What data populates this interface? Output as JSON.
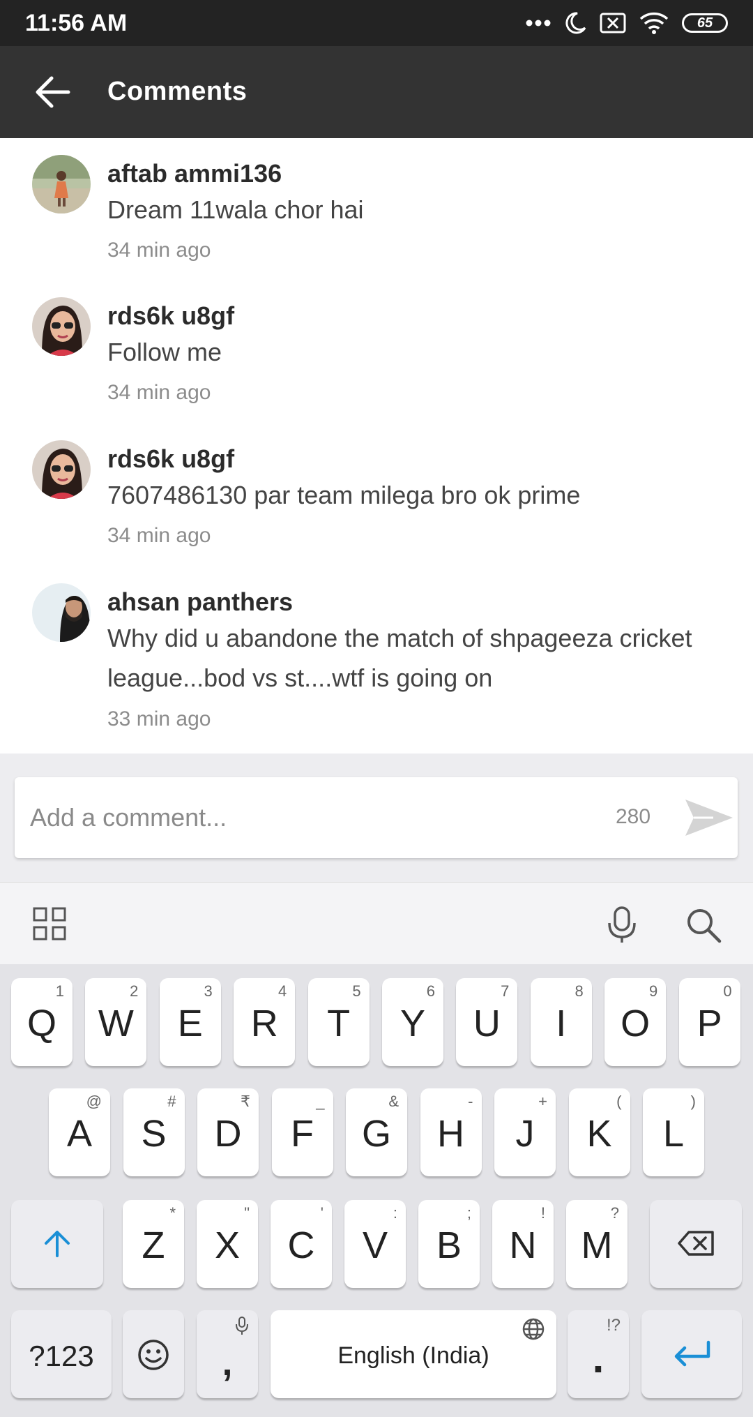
{
  "status_bar": {
    "time": "11:56 AM",
    "battery": "65",
    "icons": [
      "more-dots-icon",
      "moon-icon",
      "data-off-icon",
      "wifi-icon",
      "battery-icon"
    ]
  },
  "app_bar": {
    "title": "Comments",
    "back_icon": "back-arrow-icon"
  },
  "comments": [
    {
      "author": "aftab ammi136",
      "text": "Dream 11wala chor hai",
      "time": "34 min ago"
    },
    {
      "author": "rds6k u8gf",
      "text": "Follow me",
      "time": "34 min ago"
    },
    {
      "author": "rds6k u8gf",
      "text": "7607486130 par team milega bro ok prime",
      "time": "34 min ago"
    },
    {
      "author": "ahsan panthers",
      "text": "Why did u abandone the match of shpageeza cricket league...bod vs st....wtf is going on",
      "time": "33 min ago"
    }
  ],
  "comment_input": {
    "placeholder": "Add a comment...",
    "value": "",
    "char_count": "280"
  },
  "keyboard": {
    "toolbar": [
      "grid-icon",
      "microphone-icon",
      "search-icon"
    ],
    "row1": [
      {
        "key": "Q",
        "sub": "1"
      },
      {
        "key": "W",
        "sub": "2"
      },
      {
        "key": "E",
        "sub": "3"
      },
      {
        "key": "R",
        "sub": "4"
      },
      {
        "key": "T",
        "sub": "5"
      },
      {
        "key": "Y",
        "sub": "6"
      },
      {
        "key": "U",
        "sub": "7"
      },
      {
        "key": "I",
        "sub": "8"
      },
      {
        "key": "O",
        "sub": "9"
      },
      {
        "key": "P",
        "sub": "0"
      }
    ],
    "row2": [
      {
        "key": "A",
        "sub": "@"
      },
      {
        "key": "S",
        "sub": "#"
      },
      {
        "key": "D",
        "sub": "₹"
      },
      {
        "key": "F",
        "sub": "_"
      },
      {
        "key": "G",
        "sub": "&"
      },
      {
        "key": "H",
        "sub": "-"
      },
      {
        "key": "J",
        "sub": "+"
      },
      {
        "key": "K",
        "sub": "("
      },
      {
        "key": "L",
        "sub": ")"
      }
    ],
    "row3": [
      {
        "key": "Z",
        "sub": "*"
      },
      {
        "key": "X",
        "sub": "\""
      },
      {
        "key": "C",
        "sub": "'"
      },
      {
        "key": "V",
        "sub": ":"
      },
      {
        "key": "B",
        "sub": ";"
      },
      {
        "key": "N",
        "sub": "!"
      },
      {
        "key": "M",
        "sub": "?"
      }
    ],
    "symbols_key": "?123",
    "comma_key": ",",
    "space_label": "English (India)",
    "period_key": ".",
    "period_sub": "!?"
  },
  "colors": {
    "status_bar": "#232323",
    "app_bar": "#333333",
    "accent_blue": "#1a8fd6"
  }
}
